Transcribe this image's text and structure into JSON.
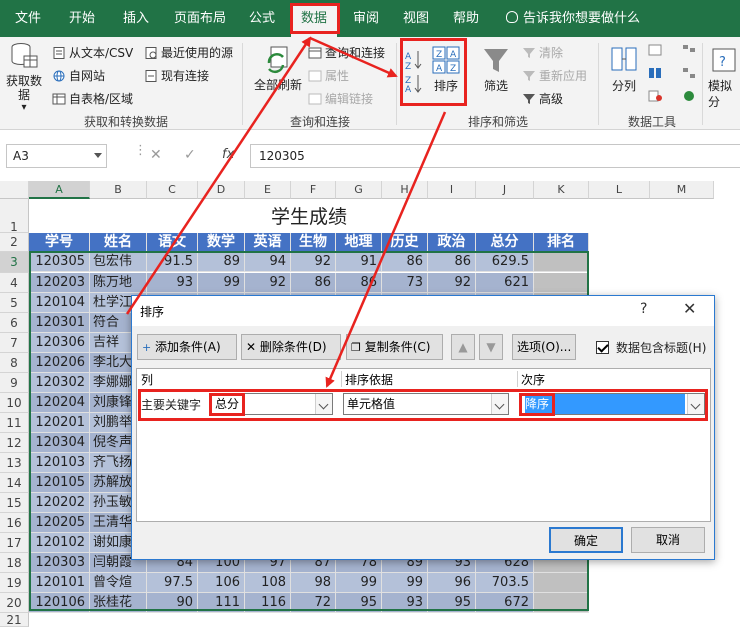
{
  "tabs": [
    "文件",
    "开始",
    "插入",
    "页面布局",
    "公式",
    "数据",
    "审阅",
    "视图",
    "帮助"
  ],
  "tell_me": "告诉我你想要做什么",
  "ribbon": {
    "get_data": "获取数据",
    "get_data_arrow": "▾",
    "from_text_csv": "从文本/CSV",
    "from_web": "自网站",
    "from_table": "自表格/区域",
    "recent_sources": "最近使用的源",
    "existing_connections": "现有连接",
    "group_get_transform": "获取和转换数据",
    "refresh_all": "全部刷新",
    "queries_connections": "查询和连接",
    "properties": "属性",
    "edit_links": "编辑链接",
    "group_queries": "查询和连接",
    "sort": "排序",
    "filter": "筛选",
    "clear": "清除",
    "reapply": "重新应用",
    "advanced": "高级",
    "group_sort_filter": "排序和筛选",
    "text_to_columns": "分列",
    "group_data_tools": "数据工具",
    "what_if": "模拟分"
  },
  "formula_bar": {
    "name_box": "A3",
    "fx": "fx",
    "content": "120305"
  },
  "sheet": {
    "columns": [
      "A",
      "B",
      "C",
      "D",
      "E",
      "F",
      "G",
      "H",
      "I",
      "J",
      "K",
      "L",
      "M"
    ],
    "title": "学生成绩",
    "headers": [
      "学号",
      "姓名",
      "语文",
      "数学",
      "英语",
      "生物",
      "地理",
      "历史",
      "政治",
      "总分",
      "排名"
    ],
    "rows": [
      {
        "num": "1"
      },
      {
        "num": "2"
      },
      {
        "num": "3",
        "cells": [
          "120305",
          "包宏伟",
          "91.5",
          "89",
          "94",
          "92",
          "91",
          "86",
          "86",
          "629.5",
          ""
        ]
      },
      {
        "num": "4",
        "cells": [
          "120203",
          "陈万地",
          "93",
          "99",
          "92",
          "86",
          "86",
          "73",
          "92",
          "621",
          ""
        ]
      },
      {
        "num": "5",
        "cells": [
          "120104",
          "杜学江",
          "",
          "",
          "",
          "",
          "",
          "",
          "",
          "",
          ""
        ]
      },
      {
        "num": "6",
        "cells": [
          "120301",
          "符合",
          "",
          "",
          "",
          "",
          "",
          "",
          "",
          "",
          ""
        ]
      },
      {
        "num": "7",
        "cells": [
          "120306",
          "吉祥",
          "",
          "",
          "",
          "",
          "",
          "",
          "",
          "",
          ""
        ]
      },
      {
        "num": "8",
        "cells": [
          "120206",
          "李北大",
          "",
          "",
          "",
          "",
          "",
          "",
          "",
          "",
          ""
        ]
      },
      {
        "num": "9",
        "cells": [
          "120302",
          "李娜娜",
          "",
          "",
          "",
          "",
          "",
          "",
          "",
          "",
          ""
        ]
      },
      {
        "num": "10",
        "cells": [
          "120204",
          "刘康锋",
          "",
          "",
          "",
          "",
          "",
          "",
          "",
          "",
          ""
        ]
      },
      {
        "num": "11",
        "cells": [
          "120201",
          "刘鹏举",
          "",
          "",
          "",
          "",
          "",
          "",
          "",
          "",
          ""
        ]
      },
      {
        "num": "12",
        "cells": [
          "120304",
          "倪冬声",
          "",
          "",
          "",
          "",
          "",
          "",
          "",
          "",
          ""
        ]
      },
      {
        "num": "13",
        "cells": [
          "120103",
          "齐飞扬",
          "",
          "",
          "",
          "",
          "",
          "",
          "",
          "",
          ""
        ]
      },
      {
        "num": "14",
        "cells": [
          "120105",
          "苏解放",
          "",
          "",
          "",
          "",
          "",
          "",
          "",
          "",
          ""
        ]
      },
      {
        "num": "15",
        "cells": [
          "120202",
          "孙玉敏",
          "",
          "",
          "",
          "",
          "",
          "",
          "",
          "",
          ""
        ]
      },
      {
        "num": "16",
        "cells": [
          "120205",
          "王清华",
          "",
          "",
          "",
          "",
          "",
          "",
          "",
          "",
          ""
        ]
      },
      {
        "num": "17",
        "cells": [
          "120102",
          "谢如康",
          "",
          "",
          "",
          "",
          "",
          "",
          "",
          "",
          ""
        ]
      },
      {
        "num": "18",
        "cells": [
          "120303",
          "闫朝霞",
          "84",
          "100",
          "97",
          "87",
          "78",
          "89",
          "93",
          "628",
          ""
        ]
      },
      {
        "num": "19",
        "cells": [
          "120101",
          "曾令煊",
          "97.5",
          "106",
          "108",
          "98",
          "99",
          "99",
          "96",
          "703.5",
          ""
        ]
      },
      {
        "num": "20",
        "cells": [
          "120106",
          "张桂花",
          "90",
          "111",
          "116",
          "72",
          "95",
          "93",
          "95",
          "672",
          ""
        ]
      },
      {
        "num": "21"
      }
    ]
  },
  "dialog": {
    "title": "排序",
    "help": "?",
    "close": "✕",
    "add_condition": "添加条件(A)",
    "delete_condition": "删除条件(D)",
    "copy_condition": "复制条件(C)",
    "options": "选项(O)...",
    "has_header": "数据包含标题(H)",
    "col_header_column": "列",
    "col_header_sort_on": "排序依据",
    "col_header_order": "次序",
    "primary_key_label": "主要关键字",
    "primary_key_value": "总分",
    "sort_on_value": "单元格值",
    "order_value": "降序",
    "ok": "确定",
    "cancel": "取消"
  },
  "colors": {
    "excel_green": "#217346",
    "header_blue": "#4472c4",
    "highlight_red": "#e8231f",
    "band": "#b4c1d9"
  }
}
